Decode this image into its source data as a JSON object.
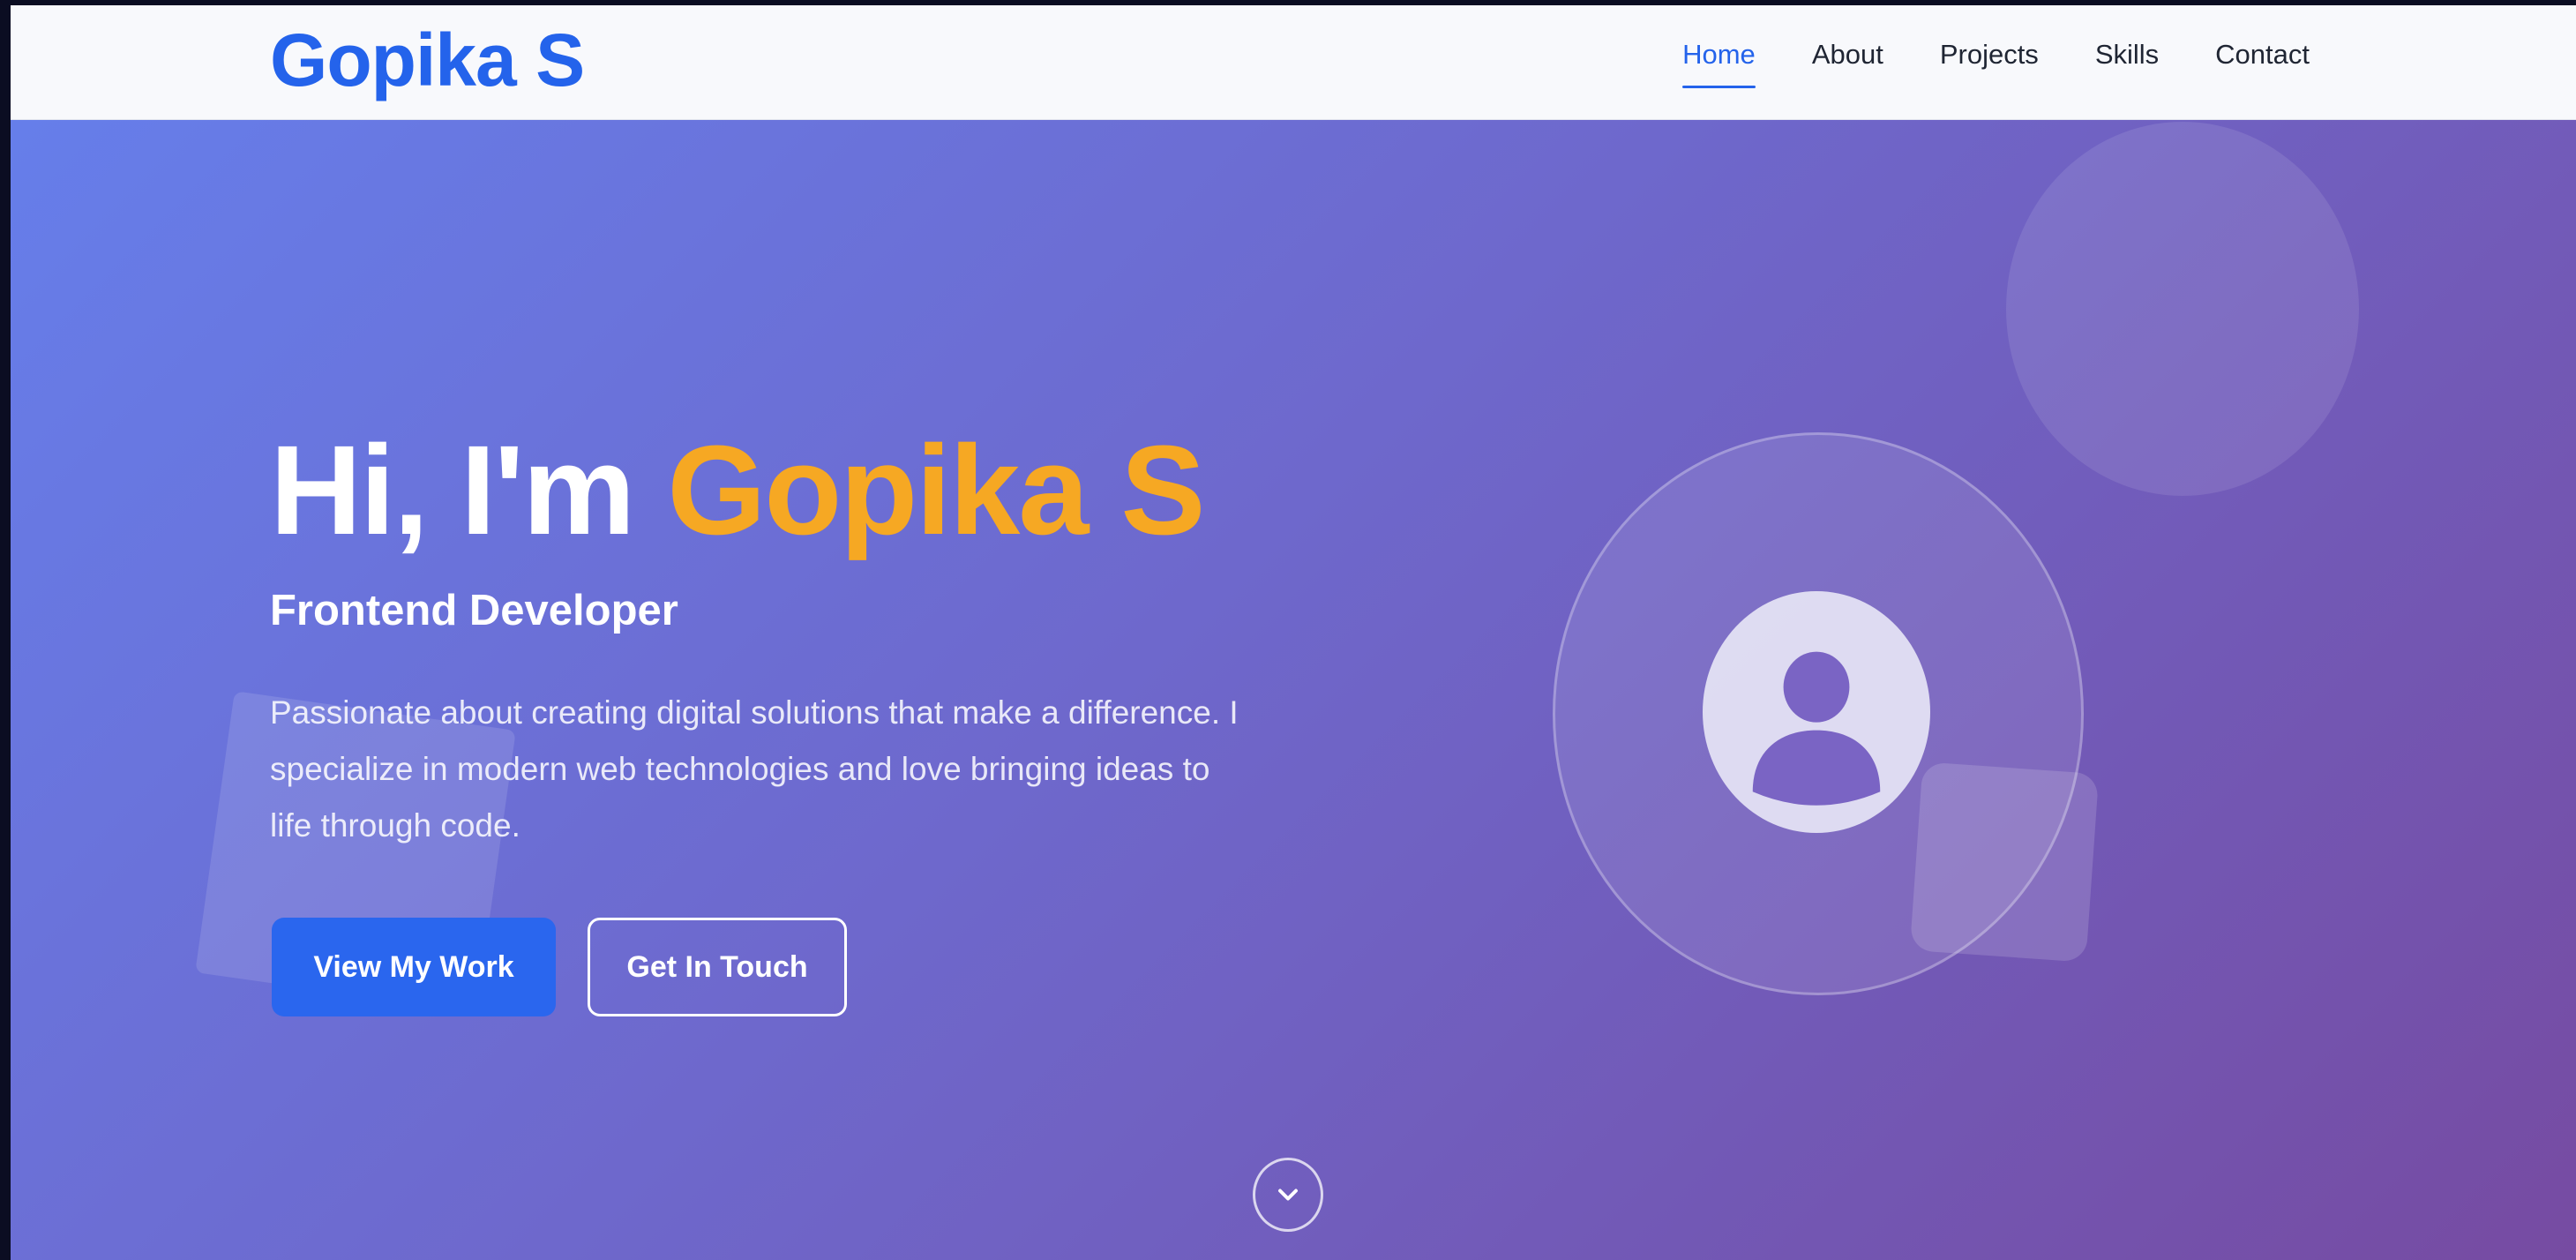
{
  "brand": {
    "logo_text": "Gopika S",
    "accent": "#2463eb"
  },
  "nav": {
    "items": [
      {
        "label": "Home",
        "active": true
      },
      {
        "label": "About",
        "active": false
      },
      {
        "label": "Projects",
        "active": false
      },
      {
        "label": "Skills",
        "active": false
      },
      {
        "label": "Contact",
        "active": false
      }
    ]
  },
  "hero": {
    "greeting": "Hi, I'm ",
    "name": "Gopika S",
    "name_color": "#f6a823",
    "subtitle": "Frontend Developer",
    "description": "Passionate about creating digital solutions that make a difference. I specialize in modern web technologies and love bringing ideas to life through code.",
    "gradient_start": "#667eea",
    "gradient_end": "#764ba2",
    "primary_button": "View My Work",
    "secondary_button": "Get In Touch",
    "avatar_icon": "user-avatar-icon",
    "scroll_icon": "chevron-down-icon"
  }
}
